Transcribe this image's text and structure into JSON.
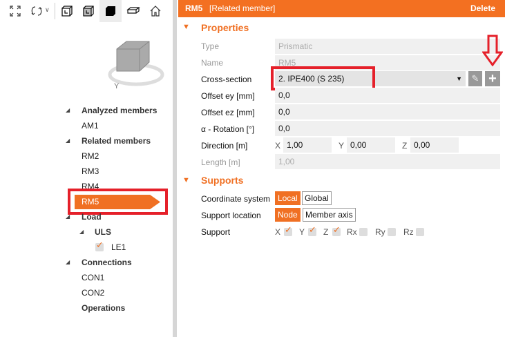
{
  "toolbar": {
    "icons": [
      "zoom-extents-icon",
      "rotate-icon",
      "wireframe-view-icon",
      "transparent-view-icon",
      "solid-view-icon",
      "section-view-icon",
      "home-icon"
    ]
  },
  "tree": {
    "analyzed_members": "Analyzed members",
    "am1": "AM1",
    "related_members": "Related members",
    "rm2": "RM2",
    "rm3": "RM3",
    "rm4": "RM4",
    "rm5": "RM5",
    "load": "Load",
    "uls": "ULS",
    "le1": "LE1",
    "connections": "Connections",
    "con1": "CON1",
    "con2": "CON2",
    "operations": "Operations"
  },
  "header": {
    "title": "RM5",
    "subtitle": "[Related member]",
    "delete": "Delete",
    "color": "#f37021"
  },
  "properties": {
    "heading": "Properties",
    "type_label": "Type",
    "type_value": "Prismatic",
    "name_label": "Name",
    "name_value": "RM5",
    "cross_label": "Cross-section",
    "cross_value": "2. IPE400 (S 235)",
    "ey_label": "Offset ey [mm]",
    "ey_value": "0,0",
    "ez_label": "Offset ez [mm]",
    "ez_value": "0,0",
    "rot_label": "α - Rotation [°]",
    "rot_value": "0,0",
    "dir_label": "Direction [m]",
    "dir_x": "X",
    "dir_x_value": "1,00",
    "dir_y": "Y",
    "dir_y_value": "0,00",
    "dir_z": "Z",
    "dir_z_value": "0,00",
    "len_label": "Length [m]",
    "len_value": "1,00"
  },
  "supports": {
    "heading": "Supports",
    "coord_label": "Coordinate system",
    "local": "Local",
    "global": "Global",
    "loc_label": "Support location",
    "node": "Node",
    "member_axis": "Member axis",
    "support_label": "Support",
    "dofs": [
      {
        "l": "X",
        "checked": true
      },
      {
        "l": "Y",
        "checked": true
      },
      {
        "l": "Z",
        "checked": true
      },
      {
        "l": "Rx",
        "checked": false
      },
      {
        "l": "Ry",
        "checked": false
      },
      {
        "l": "Rz",
        "checked": false
      }
    ]
  }
}
